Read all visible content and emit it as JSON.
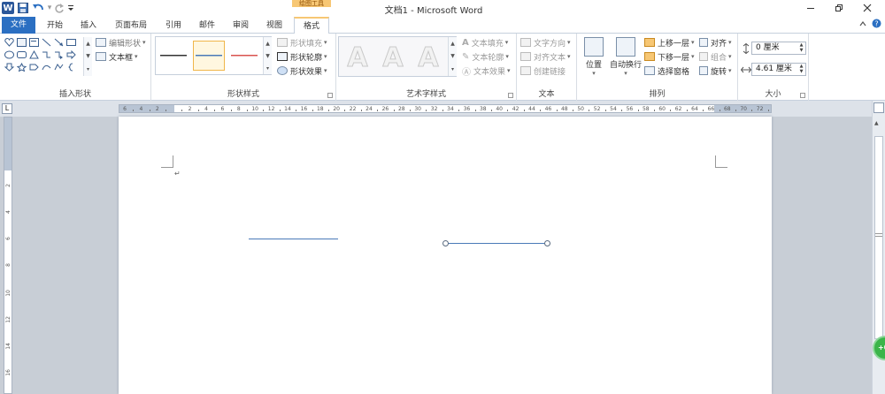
{
  "window": {
    "title": "文档1 - Microsoft Word",
    "context_group_title": "绘图工具",
    "logo_letter": "W"
  },
  "tabs": [
    {
      "label": "文件"
    },
    {
      "label": "开始"
    },
    {
      "label": "插入"
    },
    {
      "label": "页面布局"
    },
    {
      "label": "引用"
    },
    {
      "label": "邮件"
    },
    {
      "label": "审阅"
    },
    {
      "label": "视图"
    },
    {
      "label": "格式"
    }
  ],
  "groups": {
    "insert_shapes": {
      "label": "插入形状",
      "edit_shape": "编辑形状",
      "text_box": "文本框"
    },
    "shape_styles": {
      "label": "形状样式",
      "fill": "形状填充",
      "outline": "形状轮廓",
      "effects": "形状效果",
      "style_colors": [
        "#333333",
        "#4a7ab8",
        "#d9534f"
      ]
    },
    "wordart_styles": {
      "label": "艺术字样式",
      "thumb_letter": "A",
      "text_fill": "文本填充",
      "text_outline": "文本轮廓",
      "text_effects": "文本效果"
    },
    "text": {
      "label": "文本",
      "direction": "文字方向",
      "align_text": "对齐文本",
      "create_link": "创建链接"
    },
    "arrange": {
      "label": "排列",
      "position": "位置",
      "wrap_text": "自动换行",
      "bring_forward": "上移一层",
      "send_backward": "下移一层",
      "selection_pane": "选择窗格",
      "align": "对齐",
      "group": "组合",
      "rotate": "旋转"
    },
    "size": {
      "label": "大小",
      "height": "0 厘米",
      "width": "4.61 厘米"
    }
  },
  "ruler": {
    "h_labels": [
      "6",
      "4",
      "2",
      "",
      "2",
      "4",
      "6",
      "8",
      "10",
      "12",
      "14",
      "16",
      "18",
      "20",
      "22",
      "24",
      "26",
      "28",
      "30",
      "32",
      "34",
      "36",
      "38",
      "40",
      "42",
      "44",
      "46",
      "48",
      "50",
      "52",
      "54",
      "56",
      "58",
      "60",
      "62",
      "64",
      "66",
      "68",
      "70",
      "72"
    ],
    "v_labels": [
      "2",
      "4",
      "6",
      "8",
      "10",
      "12",
      "14",
      "16"
    ],
    "corner_glyph": "L"
  },
  "document": {
    "paragraph_mark": "↵"
  },
  "badge": {
    "text": "+0"
  }
}
